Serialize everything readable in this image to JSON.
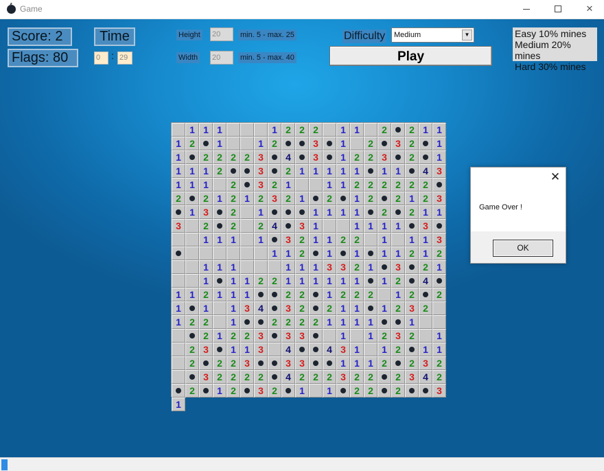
{
  "window": {
    "title": "Game",
    "close_glyph": "✕",
    "icon": "bomb-icon"
  },
  "hud": {
    "score": "Score: 2",
    "flags": "Flags: 80",
    "time_label": "Time",
    "time_minutes": "0",
    "time_colon": ":",
    "time_seconds": "29"
  },
  "settings": {
    "height_label": "Height",
    "height_value": "20",
    "height_range": "min. 5 - max. 25",
    "width_label": "Width",
    "width_value": "20",
    "width_range": "min. 5 - max. 40",
    "difficulty_label": "Difficulty",
    "difficulty_selected": "Medium",
    "dropdown_arrow": "▼",
    "play_label": "Play"
  },
  "info": {
    "easy": "Easy 10% mines",
    "medium": "Medium 20% mines",
    "hard": "Hard 30% mines"
  },
  "board": {
    "rows": 20,
    "cols": 20,
    "grid": [
      "_111___1222_11_2*211",
      "12*1__12**3*1_2*32*1",
      "1*22223*4*3*1223*2*1",
      "1112**3*211111*11*431",
      "11_2*321__11222222*2",
      "*21212321*2*12*2123*",
      "13*2_1***1111*2*2113",
      "_2*2_24*31__1111*3*_",
      "_111_1*321122_1_113*",
      "______112*1*1*11212_",
      "_111___1113321*3*21_",
      "_1*1122111111*12*4*1",
      "12111**22*1222_12*21",
      "*1_134*32*211*1232_1",
      "22_1**22221111**1___",
      "*21223*33*_1_1232_1_",
      "23*113_4**431_12*11_",
      "2*223**33**1112*232_",
      "*32222*4222322*2342*",
      "2*12*32*1_1*22*2**31"
    ]
  },
  "dialog": {
    "message": "Game Over !",
    "ok_label": "OK",
    "close_glyph": "✕"
  },
  "status": {
    "progress": 0.01
  },
  "colors": {
    "one": "#2421c8",
    "two": "#1a8a1a",
    "three": "#d41d1d",
    "four": "#101070",
    "mine": "#1c2430",
    "background": "#1689cc"
  }
}
